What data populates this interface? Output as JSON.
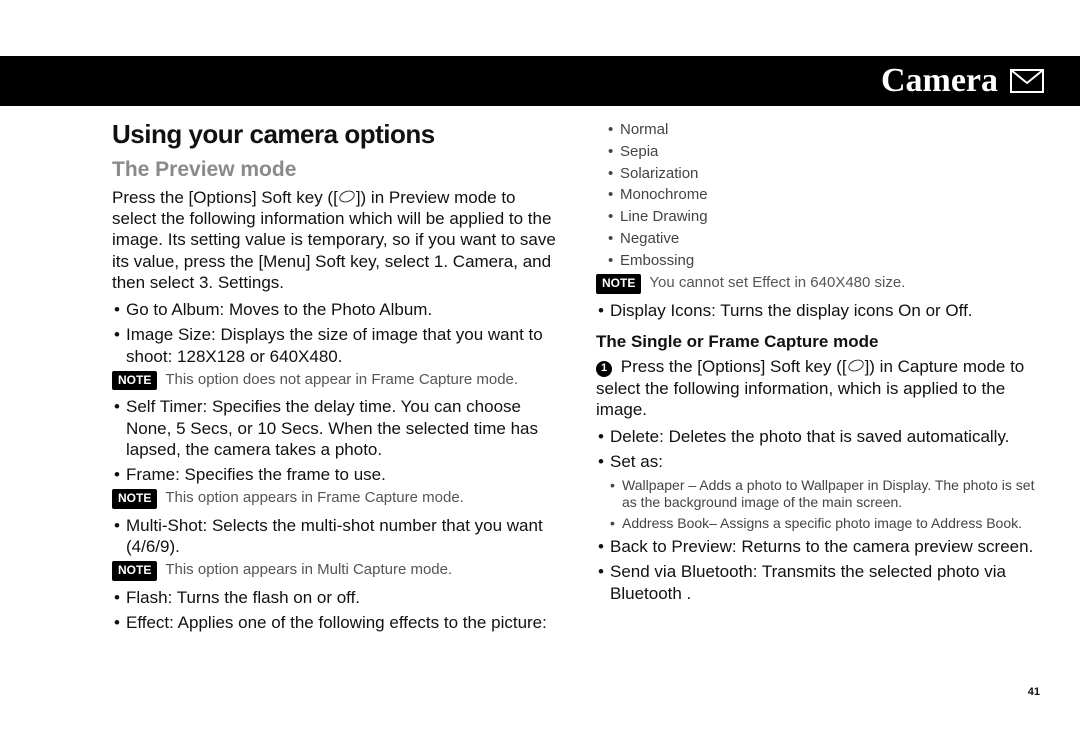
{
  "header": {
    "title": "Camera",
    "icon": "envelope-icon"
  },
  "left": {
    "h1": "Using your camera options",
    "h2": "The Preview mode",
    "intro_a": "Press the [Options] Soft key ([",
    "intro_b": "]) in Preview mode to select the following information which will be applied to the image. Its setting value is temporary, so if you want to save its value, press the [Menu] Soft key, select 1. Camera, and then select 3. Settings.",
    "b1": "Go to Album: Moves to the Photo Album.",
    "b2": "Image Size: Displays the size of image that you want to shoot: 128X128 or 640X480.",
    "note_label": "NOTE",
    "note1": "This option does not appear in Frame Capture mode.",
    "b3": "Self Timer: Specifies the delay time. You can choose None, 5 Secs, or 10 Secs. When the selected time has lapsed, the camera takes a photo.",
    "b4": "Frame: Specifies the frame to use.",
    "note2": "This option appears in Frame Capture mode.",
    "b5": "Multi-Shot: Selects the multi-shot number that you want (4/6/9).",
    "note3": "This option appears in Multi Capture mode.",
    "b6": "Flash: Turns the flash on or off.",
    "b7": "Effect: Applies one of the following effects to the picture:"
  },
  "right": {
    "effects": {
      "e1": "Normal",
      "e2": "Sepia",
      "e3": "Solarization",
      "e4": "Monochrome",
      "e5": "Line Drawing",
      "e6": "Negative",
      "e7": "Embossing"
    },
    "note4": "You cannot set Effect in 640X480 size.",
    "b1": "Display Icons: Turns the display icons On or Off.",
    "h3": "The Single or Frame Capture mode",
    "step1_a": "Press the [Options] Soft key ([",
    "step1_b": "]) in Capture mode to select the following information, which is applied to the image.",
    "bdel": "Delete: Deletes the photo that is saved automatically.",
    "bset": "Set as:",
    "sub1": "Wallpaper – Adds a photo to Wallpaper in Display. The photo is set as the background image of the main screen.",
    "sub2": "Address Book– Assigns a specific photo image to Address Book.",
    "bback": "Back to Preview: Returns to the camera preview screen.",
    "bbt": "Send via Bluetooth: Transmits the selected photo via Bluetooth ."
  },
  "page_number": "41"
}
